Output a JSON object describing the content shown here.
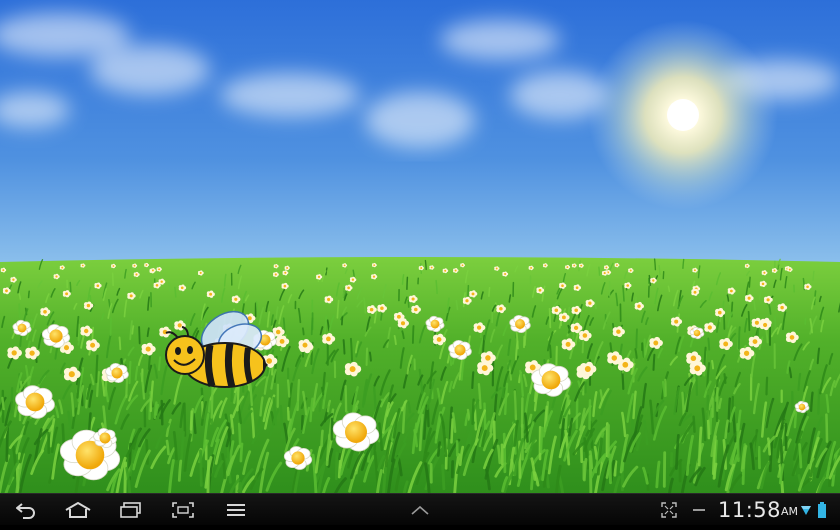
{
  "wallpaper": {
    "name": "bee-meadow-live-wallpaper",
    "colors": {
      "sky_top": "#2d6fd9",
      "sky_bottom": "#7fb8ea",
      "grass": "#4caf2a",
      "bee_yellow": "#f6c21c"
    }
  },
  "navbar": {
    "left_buttons": [
      {
        "name": "back-button",
        "icon": "back-arrow-icon"
      },
      {
        "name": "home-button",
        "icon": "home-icon"
      },
      {
        "name": "recent-apps-button",
        "icon": "recent-apps-icon"
      },
      {
        "name": "screenshot-button",
        "icon": "screenshot-icon"
      },
      {
        "name": "menu-button",
        "icon": "menu-icon"
      }
    ],
    "center_button": {
      "name": "expand-up-button",
      "icon": "chevron-up-icon"
    },
    "status": {
      "time": "11:58",
      "ampm": "AM",
      "icons": [
        "fullscreen-icon",
        "usb-debug-icon",
        "wifi-icon",
        "battery-icon"
      ]
    }
  }
}
